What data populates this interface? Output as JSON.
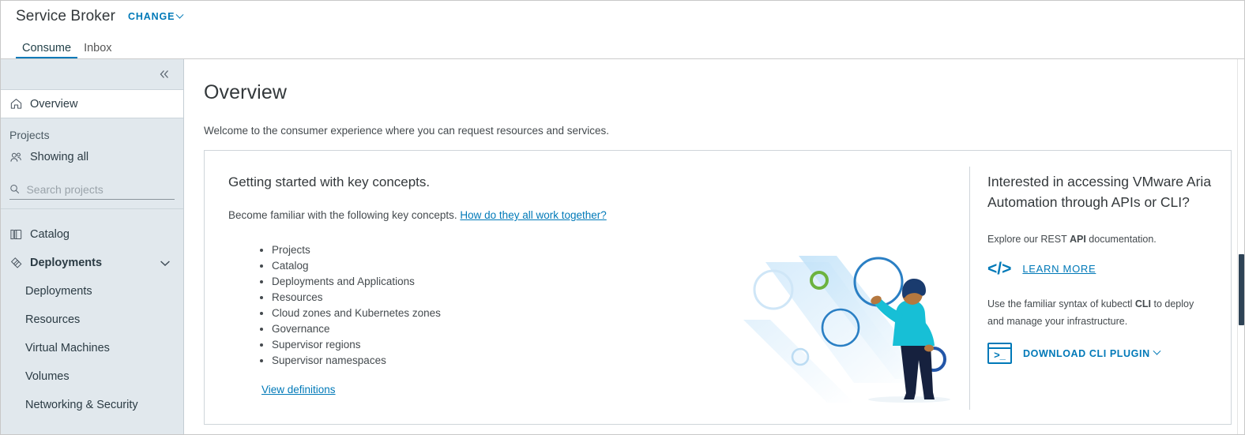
{
  "header": {
    "brand_title": "Service Broker",
    "change_label": "CHANGE",
    "change_icon": "chevron-down-icon",
    "tabs": [
      {
        "label": "Consume",
        "active": true
      },
      {
        "label": "Inbox",
        "active": false
      }
    ]
  },
  "sidebar": {
    "collapse_icon": "double-chevron-left-icon",
    "overview": {
      "label": "Overview",
      "icon": "home-icon",
      "selected": true
    },
    "projects": {
      "label": "Projects",
      "showing_label": "Showing all",
      "showing_icon": "users-icon",
      "search_icon": "search-icon",
      "search_placeholder": "Search projects",
      "search_value": ""
    },
    "nav": [
      {
        "label": "Catalog",
        "icon": "catalog-icon",
        "type": "item"
      },
      {
        "label": "Deployments",
        "icon": "deployments-icon",
        "type": "group",
        "expanded": true,
        "chevron": "chevron-down-icon"
      },
      {
        "label": "Deployments",
        "type": "sub"
      },
      {
        "label": "Resources",
        "type": "sub"
      },
      {
        "label": "Virtual Machines",
        "type": "sub"
      },
      {
        "label": "Volumes",
        "type": "sub"
      },
      {
        "label": "Networking & Security",
        "type": "sub",
        "clipped": true
      }
    ]
  },
  "main": {
    "page_title": "Overview",
    "page_subtitle": "Welcome to the consumer experience where you can request resources and services.",
    "card": {
      "heading": "Getting started with key concepts.",
      "intro_text": "Become familiar with the following key concepts.",
      "intro_link": "How do they all work together?",
      "concepts": [
        "Projects",
        "Catalog",
        "Deployments and Applications",
        "Resources",
        "Cloud zones and Kubernetes zones",
        "Governance",
        "Supervisor regions",
        "Supervisor namespaces"
      ],
      "view_definitions_link": "View definitions",
      "illustration": "person-with-circles-illustration",
      "right": {
        "heading": "Interested in accessing VMware Aria Automation through APIs or CLI?",
        "api_text_before": "Explore our REST ",
        "api_text_bold": "API",
        "api_text_after": " documentation.",
        "learn_more_label": "LEARN MORE",
        "learn_more_icon": "code-brackets-icon",
        "cli_text_before": "Use the familiar syntax of kubectl ",
        "cli_text_bold": "CLI",
        "cli_text_after": " to deploy and manage your infrastructure.",
        "download_label": "DOWNLOAD CLI PLUGIN",
        "download_icon": "terminal-icon",
        "download_chevron": "chevron-down-icon"
      }
    }
  },
  "colors": {
    "accent_blue": "#0079b8",
    "sidebar_bg": "#e1e8ed",
    "text_dark": "#33383b",
    "illustration_teal": "#17bfd6",
    "illustration_navy": "#16213e",
    "illustration_green": "#6cb33f",
    "scrollbar_thumb": "#2e4356"
  },
  "scrollbar": {
    "thumb_top_pct": 52,
    "thumb_height_pct": 19
  }
}
